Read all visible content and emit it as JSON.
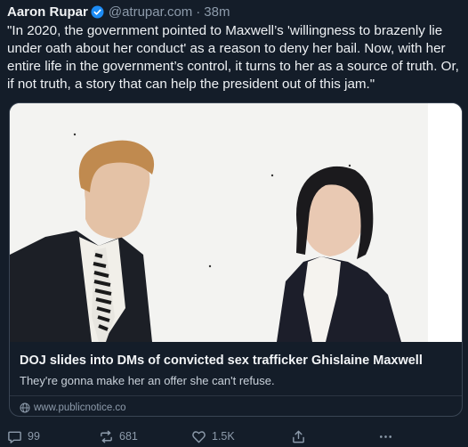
{
  "post": {
    "author": "Aaron Rupar",
    "handle": "@atrupar.com",
    "separator": "·",
    "time": "38m",
    "text": "\"In 2020, the government pointed to Maxwell’s 'willingness to brazenly lie under oath about her conduct' as a reason to deny her bail. Now, with her entire life in the government’s control, it turns to her as a source of truth. Or, if not truth, a story that can help the president out of this jam.\""
  },
  "card": {
    "title": "DOJ slides into DMs of convicted sex trafficker Ghislaine Maxwell",
    "description": "They're gonna make her an offer she can't refuse.",
    "url": "www.publicnotice.co"
  },
  "actions": {
    "replies": "99",
    "reposts": "681",
    "likes": "1.5K"
  },
  "colors": {
    "background": "#141d29",
    "verified": "#1d8cf5",
    "muted": "#8d9bab",
    "border": "#3a4554"
  },
  "icons": [
    "verified-badge-icon",
    "globe-icon",
    "reply-icon",
    "repost-icon",
    "like-icon",
    "share-icon",
    "more-icon"
  ]
}
